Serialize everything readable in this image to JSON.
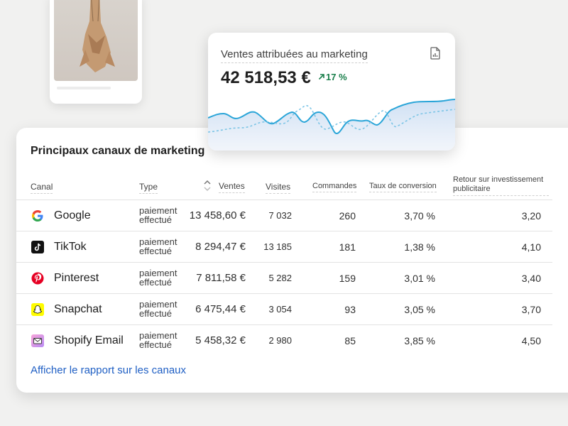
{
  "kpi": {
    "label": "Ventes attribuées au marketing",
    "value": "42 518,53 €",
    "change": "17 %",
    "trend": "up",
    "colors": {
      "current": "#2aa5d8",
      "previous": "#7cc5e6",
      "positive": "#1a7f4b"
    }
  },
  "table": {
    "title": "Principaux canaux de marketing",
    "headers": {
      "canal": "Canal",
      "type": "Type",
      "ventes": "Ventes",
      "visites": "Visites",
      "commandes": "Commandes",
      "taux": "Taux de conversion",
      "roi": "Retour sur investissement publicitaire"
    },
    "rows": [
      {
        "icon": "google-icon",
        "name": "Google",
        "type": "paiement effectué",
        "ventes": "13 458,60 €",
        "visites": "7 032",
        "commandes": "260",
        "taux": "3,70 %",
        "roi": "3,20"
      },
      {
        "icon": "tiktok-icon",
        "name": "TikTok",
        "type": "paiement effectué",
        "ventes": "8 294,47 €",
        "visites": "13 185",
        "commandes": "181",
        "taux": "1,38 %",
        "roi": "4,10"
      },
      {
        "icon": "pinterest-icon",
        "name": "Pinterest",
        "type": "paiement effectué",
        "ventes": "7 811,58 €",
        "visites": "5 282",
        "commandes": "159",
        "taux": "3,01 %",
        "roi": "3,40"
      },
      {
        "icon": "snapchat-icon",
        "name": "Snapchat",
        "type": "paiement effectué",
        "ventes": "6 475,44 €",
        "visites": "3 054",
        "commandes": "93",
        "taux": "3,05 %",
        "roi": "3,70"
      },
      {
        "icon": "shopify-email-icon",
        "name": "Shopify Email",
        "type": "paiement effectué",
        "ventes": "5 458,32 €",
        "visites": "2 980",
        "commandes": "85",
        "taux": "3,85 %",
        "roi": "4,50"
      }
    ],
    "report_link": "Afficher le rapport sur les canaux"
  }
}
